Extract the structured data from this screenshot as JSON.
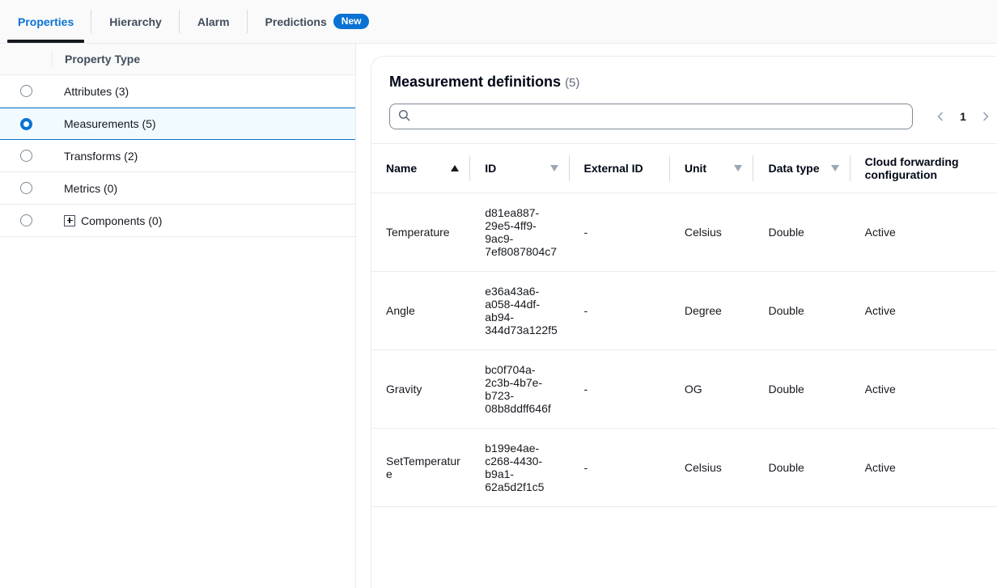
{
  "tabs": [
    {
      "label": "Properties",
      "active": true,
      "badge": null
    },
    {
      "label": "Hierarchy",
      "active": false,
      "badge": null
    },
    {
      "label": "Alarm",
      "active": false,
      "badge": null
    },
    {
      "label": "Predictions",
      "active": false,
      "badge": "New"
    }
  ],
  "property_type_panel": {
    "header": "Property Type",
    "items": [
      {
        "label": "Attributes (3)",
        "selected": false,
        "has_expand_icon": false
      },
      {
        "label": "Measurements (5)",
        "selected": true,
        "has_expand_icon": false
      },
      {
        "label": "Transforms (2)",
        "selected": false,
        "has_expand_icon": false
      },
      {
        "label": "Metrics (0)",
        "selected": false,
        "has_expand_icon": false
      },
      {
        "label": "Components (0)",
        "selected": false,
        "has_expand_icon": true
      }
    ]
  },
  "main": {
    "title": "Measurement definitions",
    "count": "(5)",
    "search": {
      "value": "",
      "placeholder": ""
    },
    "pagination": {
      "prev": "‹",
      "page": "1",
      "next": "›"
    },
    "table": {
      "columns": [
        {
          "label": "Name",
          "sort": "asc"
        },
        {
          "label": "ID",
          "sort": "none"
        },
        {
          "label": "External ID",
          "sort": null
        },
        {
          "label": "Unit",
          "sort": "none"
        },
        {
          "label": "Data type",
          "sort": "none"
        },
        {
          "label": "Cloud forwarding configuration",
          "sort": null
        }
      ],
      "rows": [
        {
          "name": "Temperature",
          "id": "d81ea887-29e5-4ff9-9ac9-7ef8087804c7",
          "external_id": "-",
          "unit": "Celsius",
          "data_type": "Double",
          "cloud_forwarding": "Active"
        },
        {
          "name": "Angle",
          "id": "e36a43a6-a058-44df-ab94-344d73a122f5",
          "external_id": "-",
          "unit": "Degree",
          "data_type": "Double",
          "cloud_forwarding": "Active"
        },
        {
          "name": "Gravity",
          "id": "bc0f704a-2c3b-4b7e-b723-08b8ddff646f",
          "external_id": "-",
          "unit": "OG",
          "data_type": "Double",
          "cloud_forwarding": "Active"
        },
        {
          "name": "SetTemperature",
          "id": "b199e4ae-c268-4430-b9a1-62a5d2f1c5",
          "external_id": "-",
          "unit": "Celsius",
          "data_type": "Double",
          "cloud_forwarding": "Active"
        }
      ]
    }
  },
  "colors": {
    "accent": "#0972d3",
    "selected_row_bg": "#f1faff",
    "border": "#e9ebed",
    "text": "#16191f",
    "muted": "#5f6b7a"
  }
}
